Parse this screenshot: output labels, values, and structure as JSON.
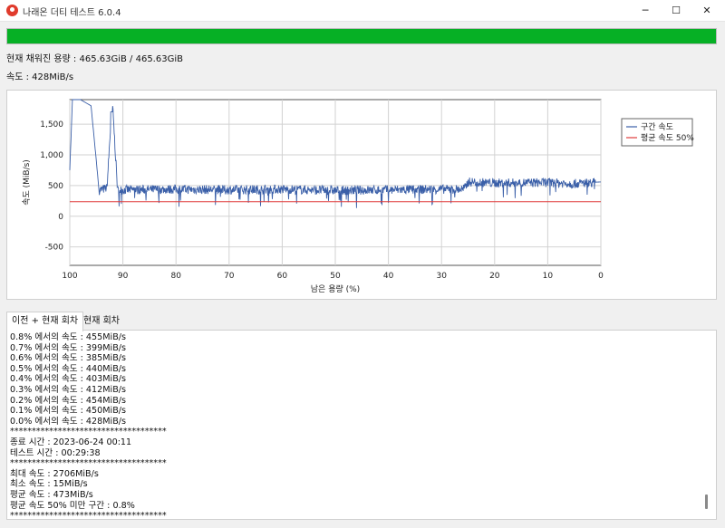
{
  "window": {
    "title": "나래온 더티 테스트 6.0.4",
    "minimize_icon": "─",
    "maximize_icon": "☐",
    "close_icon": "✕"
  },
  "progress": {
    "percent": 100,
    "color": "#06b025"
  },
  "status": {
    "capacity_text": "현재 채워진 용량 : 465.63GiB / 465.63GiB",
    "speed_text": "속도 : 428MiB/s"
  },
  "chart_data": {
    "type": "line",
    "xlabel": "남은 용량 (%)",
    "ylabel": "속도 (MiB/s)",
    "xlim": [
      100,
      0
    ],
    "ylim": [
      -800,
      1900
    ],
    "x_ticks": [
      100,
      90,
      80,
      70,
      60,
      50,
      40,
      30,
      20,
      10,
      0
    ],
    "y_ticks": [
      1500,
      1000,
      500,
      0,
      -500
    ],
    "y_tick_labels": [
      "1,500",
      "1,000",
      "500",
      "0",
      "-500"
    ],
    "grid": true,
    "legend_position": "right",
    "series": [
      {
        "name": "구간 속도",
        "color": "#3a5fa8",
        "x": [
          100,
          99.5,
          98,
          96,
          95,
          94.5,
          93,
          92,
          91,
          90,
          80,
          70,
          60,
          50,
          40,
          30,
          26,
          25.5,
          25,
          20,
          10,
          5,
          0
        ],
        "y": [
          750,
          1900,
          1900,
          1800,
          900,
          420,
          460,
          1900,
          420,
          430,
          440,
          430,
          440,
          420,
          430,
          440,
          440,
          470,
          560,
          540,
          550,
          530,
          560
        ]
      },
      {
        "name": "평균 속도 50%",
        "color": "#e03b3b",
        "x": [
          100,
          0
        ],
        "y": [
          237,
          237
        ]
      }
    ]
  },
  "tabs": [
    {
      "label": "이전 + 현재 회차",
      "active": true
    },
    {
      "label": "현재 회차",
      "active": false
    }
  ],
  "log": [
    "0.8% 에서의 속도 : 455MiB/s",
    "0.7% 에서의 속도 : 399MiB/s",
    "0.6% 에서의 속도 : 385MiB/s",
    "0.5% 에서의 속도 : 440MiB/s",
    "0.4% 에서의 속도 : 403MiB/s",
    "0.3% 에서의 속도 : 412MiB/s",
    "0.2% 에서의 속도 : 454MiB/s",
    "0.1% 에서의 속도 : 450MiB/s",
    "0.0% 에서의 속도 : 428MiB/s",
    "************************************",
    "종료 시간 : 2023-06-24 00:11",
    "테스트 시간 : 00:29:38",
    "************************************",
    "최대 속도 : 2706MiB/s",
    "최소 속도 : 15MiB/s",
    "평균 속도 : 473MiB/s",
    "평균 속도 50% 미만 구간 : 0.8%",
    "************************************"
  ]
}
